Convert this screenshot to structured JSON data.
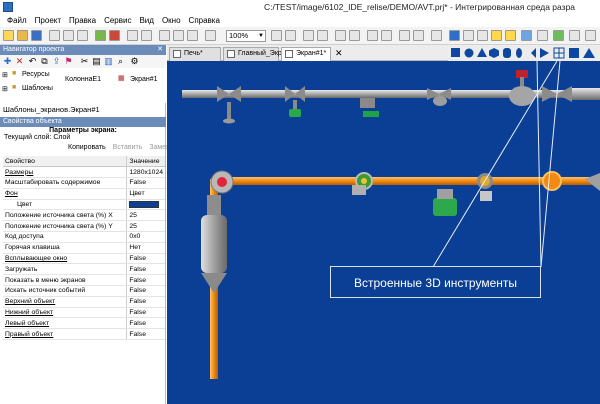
{
  "window": {
    "title": "C:/TEST/image/6102_IDE_relise/DEMO/AVT.prj* - Интегрированная среда разра"
  },
  "menu": [
    "Файл",
    "Проект",
    "Правка",
    "Сервис",
    "Вид",
    "Окно",
    "Справка"
  ],
  "toolbar": {
    "zoom": "100%"
  },
  "project_pane": {
    "title": "Навигатор проекта",
    "tree": {
      "resources": "Ресурсы",
      "templates": "Шаблоны",
      "column": "КолоннаЕ1",
      "screen": "Экран#1"
    },
    "template_path": "Шаблоны_экранов.Экран#1"
  },
  "properties_pane": {
    "title": "Свойства объекта",
    "params_heading": "Параметры экрана:",
    "current_layer_label": "Текущий слой:",
    "current_layer_value": "Слой",
    "copy": "Копировать",
    "paste": "Вставить",
    "replace": "Заменить",
    "header_property": "Свойство",
    "header_value": "Значение",
    "rows": [
      {
        "name": "Размеры",
        "value": "1280x1024"
      },
      {
        "name": "Масштабировать содержимое",
        "value": "False"
      },
      {
        "name": "Фон",
        "value": "Цвет"
      },
      {
        "name": "Цвет",
        "value": ""
      },
      {
        "name": "Положение источника света (%) X",
        "value": "25"
      },
      {
        "name": "Положение источника света (%) Y",
        "value": "25"
      },
      {
        "name": "Код доступа",
        "value": "0x0"
      },
      {
        "name": "Горячая клавиша",
        "value": "Нет"
      },
      {
        "name": "Всплывающее окно",
        "value": "False"
      },
      {
        "name": "Загружать",
        "value": "False"
      },
      {
        "name": "Показать в меню экранов",
        "value": "False"
      },
      {
        "name": "Искать источник событий",
        "value": "False"
      },
      {
        "name": "Верхний объект",
        "value": "False"
      },
      {
        "name": "Нижний объект",
        "value": "False"
      },
      {
        "name": "Левый объект",
        "value": "False"
      },
      {
        "name": "Правый объект",
        "value": "False"
      }
    ],
    "background_color": "#0a3f95"
  },
  "tabs": [
    "Печь*",
    "Главный_Экран",
    "Экран#1*"
  ],
  "canvas": {
    "background": "#0a3f95",
    "callout": "Встроенные 3D инструменты"
  },
  "icons": {
    "app": "app-icon",
    "palette": [
      "square-icon",
      "circle-icon",
      "triangle-icon",
      "hexagon-icon",
      "cylinder-icon",
      "valve-icon",
      "pump-icon",
      "table-icon",
      "grid-icon",
      "tank-icon"
    ]
  }
}
